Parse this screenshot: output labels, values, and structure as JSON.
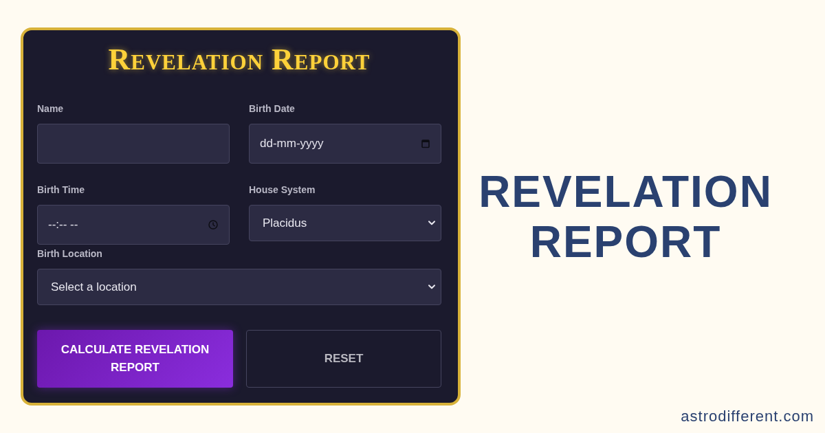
{
  "form": {
    "title": "Revelation Report",
    "fields": [
      {
        "label": "Name",
        "kind": "text"
      },
      {
        "label": "Birth Date",
        "kind": "date",
        "placeholder": "dd-mm-yyyy"
      },
      {
        "label": "Birth Time",
        "kind": "time",
        "placeholder": "--:-- --"
      },
      {
        "label": "House System",
        "kind": "select",
        "value": "Placidus"
      },
      {
        "label": "Birth Location",
        "kind": "select",
        "value": "Select a location"
      }
    ],
    "buttons": [
      {
        "label": "CALCULATE REVELATION REPORT",
        "kind": "primary"
      },
      {
        "label": "RESET",
        "kind": "outline"
      }
    ]
  },
  "banner": {
    "heading": "REVELATION REPORT",
    "site": "astrodifferent.com"
  }
}
